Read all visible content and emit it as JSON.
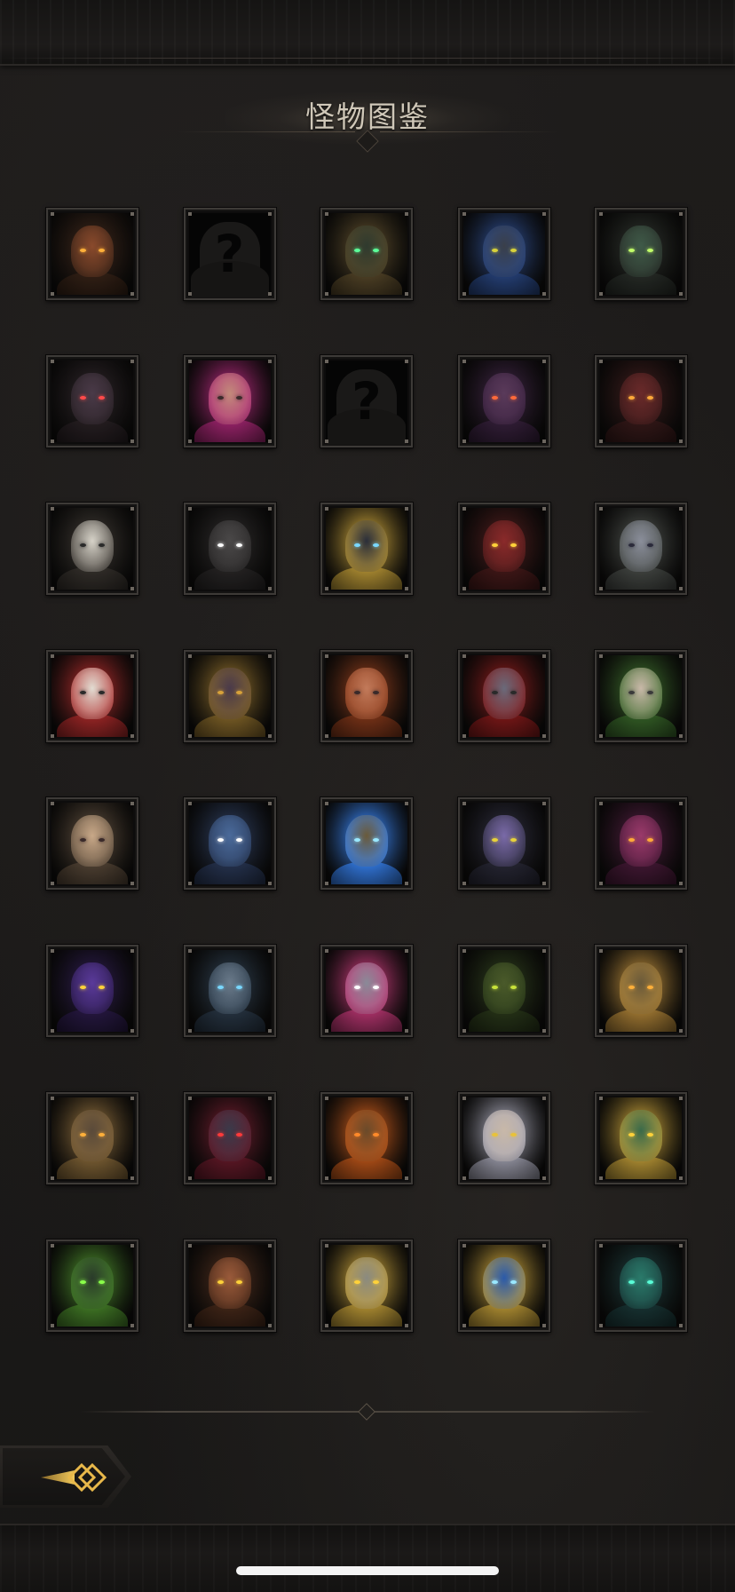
{
  "header": {
    "title": "怪物图鉴"
  },
  "monsters": [
    {
      "name": "horned-demon-portrait",
      "unlocked": true,
      "skin": "#8a4a2c",
      "accent": "#3a2418",
      "eye": "#ffb03a"
    },
    {
      "name": "unknown-monster-portrait",
      "unlocked": false,
      "label": "?"
    },
    {
      "name": "green-eyed-wraith-portrait",
      "unlocked": true,
      "skin": "#2f3a2e",
      "accent": "#5a4a2a",
      "eye": "#5cff9a"
    },
    {
      "name": "armored-beast-portrait",
      "unlocked": true,
      "skin": "#3a3f4a",
      "accent": "#2b4a8a",
      "eye": "#d8d23a"
    },
    {
      "name": "green-ghoul-portrait",
      "unlocked": true,
      "skin": "#3f5a48",
      "accent": "#2a2f2a",
      "eye": "#c2ff6a"
    },
    {
      "name": "shadow-vampire-portrait",
      "unlocked": true,
      "skin": "#4a3a48",
      "accent": "#2a2226",
      "eye": "#ff4a4a"
    },
    {
      "name": "pink-haired-woman-portrait",
      "unlocked": true,
      "skin": "#c28a7a",
      "accent": "#b0287a",
      "eye": "#3a2a2a"
    },
    {
      "name": "unknown-monster-portrait",
      "unlocked": false,
      "label": "?"
    },
    {
      "name": "many-eyed-horror-portrait",
      "unlocked": true,
      "skin": "#5a3a5a",
      "accent": "#3a2240",
      "eye": "#ff6a3a"
    },
    {
      "name": "red-maw-beast-portrait",
      "unlocked": true,
      "skin": "#6a2a2a",
      "accent": "#3a1a1a",
      "eye": "#ffaa3a"
    },
    {
      "name": "hooded-assassin-portrait",
      "unlocked": true,
      "skin": "#d6d2c8",
      "accent": "#3a3530",
      "eye": "#2a2a2a"
    },
    {
      "name": "dark-knight-helmet-portrait",
      "unlocked": true,
      "skin": "#4a4848",
      "accent": "#2a2828",
      "eye": "#ffffff"
    },
    {
      "name": "golden-crown-lich-portrait",
      "unlocked": true,
      "skin": "#2a2e3a",
      "accent": "#c8a23a",
      "eye": "#7ad8ff"
    },
    {
      "name": "red-dragon-portrait",
      "unlocked": true,
      "skin": "#8a2a2a",
      "accent": "#4a1a1a",
      "eye": "#ffd23a"
    },
    {
      "name": "hooded-pale-woman-portrait",
      "unlocked": true,
      "skin": "#8a8e9a",
      "accent": "#4a4e4a",
      "eye": "#2a2a3a"
    },
    {
      "name": "jester-clown-portrait",
      "unlocked": true,
      "skin": "#e2dcd2",
      "accent": "#b02a2a",
      "eye": "#2a2a2a"
    },
    {
      "name": "spiked-egg-creature-portrait",
      "unlocked": true,
      "skin": "#4a3a4a",
      "accent": "#8a6a2a",
      "eye": "#d8a23a"
    },
    {
      "name": "red-haired-hood-portrait",
      "unlocked": true,
      "skin": "#c27a5a",
      "accent": "#8a3a1a",
      "eye": "#3a2a2a"
    },
    {
      "name": "red-cloak-woman-portrait",
      "unlocked": true,
      "skin": "#6a6a7a",
      "accent": "#8a1a1a",
      "eye": "#2a2a2a"
    },
    {
      "name": "silver-haired-youth-portrait",
      "unlocked": true,
      "skin": "#c8b8a8",
      "accent": "#3a6a2a",
      "eye": "#3a3a3a"
    },
    {
      "name": "blonde-hooded-girl-portrait",
      "unlocked": true,
      "skin": "#c8a888",
      "accent": "#5a4a3a",
      "eye": "#3a2a2a"
    },
    {
      "name": "blue-cyclops-ogre-portrait",
      "unlocked": true,
      "skin": "#4a6a9a",
      "accent": "#2a3a5a",
      "eye": "#ffffff"
    },
    {
      "name": "blue-orb-golem-portrait",
      "unlocked": true,
      "skin": "#6a5a3a",
      "accent": "#3a8aff",
      "eye": "#9ae8ff"
    },
    {
      "name": "purple-witch-portrait",
      "unlocked": true,
      "skin": "#7a6aa8",
      "accent": "#2a2a3a",
      "eye": "#e8d23a"
    },
    {
      "name": "pink-tentacle-demon-portrait",
      "unlocked": true,
      "skin": "#9a3a6a",
      "accent": "#4a1a3a",
      "eye": "#ffaa3a"
    },
    {
      "name": "purple-beast-portrait",
      "unlocked": true,
      "skin": "#5a3a9a",
      "accent": "#2a1a4a",
      "eye": "#ffd23a"
    },
    {
      "name": "blue-furred-yeti-portrait",
      "unlocked": true,
      "skin": "#6a7a8a",
      "accent": "#2a3a4a",
      "eye": "#7ad8ff"
    },
    {
      "name": "pink-crested-undead-portrait",
      "unlocked": true,
      "skin": "#8a8a98",
      "accent": "#c83a7a",
      "eye": "#ffffff"
    },
    {
      "name": "mossy-treant-portrait",
      "unlocked": true,
      "skin": "#4a5a2a",
      "accent": "#2a3a1a",
      "eye": "#c8e23a"
    },
    {
      "name": "clockwork-golem-portrait",
      "unlocked": true,
      "skin": "#6a5a3a",
      "accent": "#b88a3a",
      "eye": "#ffb03a"
    },
    {
      "name": "rusted-mech-portrait",
      "unlocked": true,
      "skin": "#5a4a3a",
      "accent": "#8a6a3a",
      "eye": "#ffb03a"
    },
    {
      "name": "horned-vampire-lord-portrait",
      "unlocked": true,
      "skin": "#3a3a4a",
      "accent": "#6a1a2a",
      "eye": "#ff3a3a"
    },
    {
      "name": "furnace-automaton-portrait",
      "unlocked": true,
      "skin": "#6a4a2a",
      "accent": "#c85a1a",
      "eye": "#ff8a2a"
    },
    {
      "name": "elven-queen-portrait",
      "unlocked": true,
      "skin": "#c8b8a8",
      "accent": "#a8a8b8",
      "eye": "#e8c23a"
    },
    {
      "name": "green-lizard-warrior-portrait",
      "unlocked": true,
      "skin": "#3a6a4a",
      "accent": "#c8a23a",
      "eye": "#ffd23a"
    },
    {
      "name": "venom-spider-portrait",
      "unlocked": true,
      "skin": "#2a3a2a",
      "accent": "#4a8a2a",
      "eye": "#8aff4a"
    },
    {
      "name": "ratman-portrait",
      "unlocked": true,
      "skin": "#9a5a3a",
      "accent": "#4a2a1a",
      "eye": "#ffd23a"
    },
    {
      "name": "bone-hand-blade-portrait",
      "unlocked": true,
      "skin": "#8a8a80",
      "accent": "#c8a23a",
      "eye": "#ffd23a"
    },
    {
      "name": "blue-crystal-sigil-portrait",
      "unlocked": true,
      "skin": "#2a5aaa",
      "accent": "#c8a23a",
      "eye": "#9ae8ff"
    },
    {
      "name": "teal-hooded-spectre-portrait",
      "unlocked": true,
      "skin": "#2a7a6a",
      "accent": "#1a3a3a",
      "eye": "#5affd8"
    }
  ],
  "footer": {
    "back_icon": "back-arrow-icon",
    "accent_color": "#d8a23a"
  }
}
